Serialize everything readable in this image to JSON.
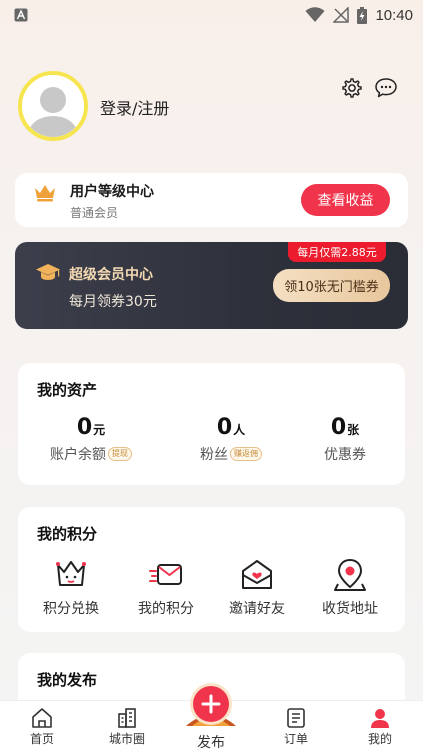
{
  "status_bar": {
    "time": "10:40",
    "left_icon": "a-letter-icon",
    "icons": [
      "wifi-icon",
      "signal-off-icon",
      "battery-charging-icon"
    ]
  },
  "header": {
    "login_label": "登录/注册",
    "settings_icon": "gear-icon",
    "message_icon": "chat-bubble-icon"
  },
  "level_card": {
    "title": "用户等级中心",
    "subtitle": "普通会员",
    "button_label": "查看收益"
  },
  "vip_card": {
    "title": "超级会员中心",
    "subtitle": "每月领券30元",
    "price_badge": "每月仅需2.88元",
    "coupon_button": "领10张无门槛券"
  },
  "assets": {
    "title": "我的资产",
    "items": [
      {
        "value": "0",
        "unit": "元",
        "label": "账户余额",
        "tag": "提现"
      },
      {
        "value": "0",
        "unit": "人",
        "label": "粉丝",
        "tag": "赚返佣"
      },
      {
        "value": "0",
        "unit": "张",
        "label": "优惠券",
        "tag": ""
      }
    ]
  },
  "points": {
    "title": "我的积分",
    "items": [
      {
        "label": "积分兑换",
        "icon": "crown-gift-icon"
      },
      {
        "label": "我的积分",
        "icon": "envelope-fast-icon"
      },
      {
        "label": "邀请好友",
        "icon": "invite-letter-icon"
      },
      {
        "label": "收货地址",
        "icon": "location-pin-icon"
      }
    ]
  },
  "posts": {
    "title": "我的发布"
  },
  "tab_bar": {
    "items": [
      {
        "label": "首页",
        "icon": "home-icon"
      },
      {
        "label": "城市圈",
        "icon": "city-icon"
      },
      {
        "label": "发布",
        "icon": "plus-icon"
      },
      {
        "label": "订单",
        "icon": "order-icon"
      },
      {
        "label": "我的",
        "icon": "person-icon"
      }
    ]
  },
  "colors": {
    "accent_red": "#f0344c",
    "vip_dark": "#2e313b",
    "gold": "#e8c79c",
    "avatar_ring": "#f7e54f"
  }
}
